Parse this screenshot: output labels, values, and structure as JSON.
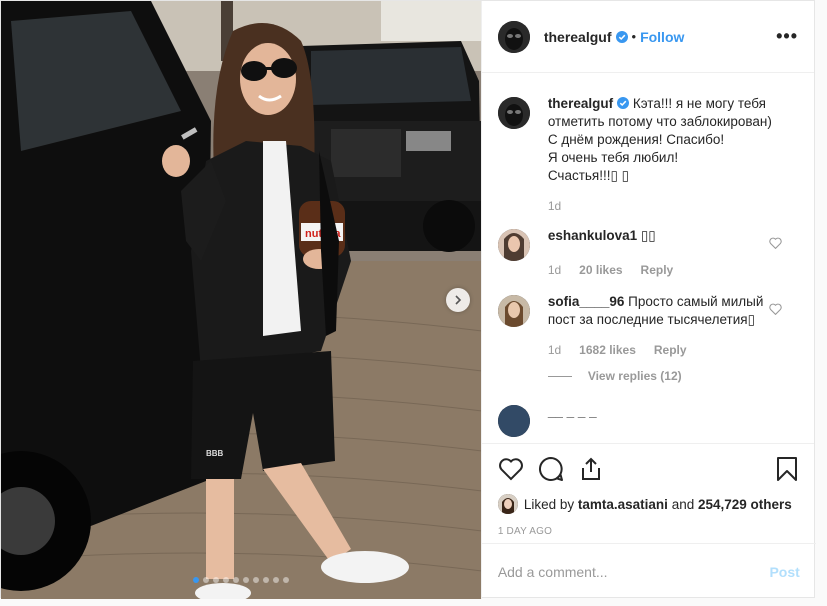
{
  "header": {
    "username": "therealguf",
    "separator": "•",
    "follow_label": "Follow",
    "more_label": "•••"
  },
  "caption": {
    "username": "therealguf",
    "lines": [
      "Кэта!!! я не могу тебя отметить потому что заблокирован)",
      "С днём рождения! Спасибо!",
      "Я очень тебя любил!",
      "Счастья!!!▯ ▯"
    ],
    "age": "1d"
  },
  "comments": [
    {
      "username": "eshankulova1",
      "text": "▯▯",
      "age": "1d",
      "likes": "20 likes",
      "reply_label": "Reply"
    },
    {
      "username": "sofia____96",
      "text": "Просто самый милый пост за последние тысячелетия▯",
      "age": "1d",
      "likes": "1682 likes",
      "reply_label": "Reply",
      "view_replies": "View replies (12)"
    },
    {
      "username": "__ _ _ _",
      "text": ""
    }
  ],
  "likes": {
    "prefix": "Liked by",
    "user": "tamta.asatiani",
    "conj": "and",
    "others": "254,729 others"
  },
  "timestamp": "1 day ago",
  "add_comment": {
    "placeholder": "Add a comment...",
    "post_label": "Post"
  },
  "icons": [
    "heart-icon",
    "comment-icon",
    "share-icon",
    "bookmark-icon",
    "verified-icon",
    "chevron-right-icon",
    "more-icon"
  ],
  "carousel": {
    "total": 10,
    "current": 1
  },
  "colors": {
    "link": "#3897f0",
    "muted": "#999999",
    "post_disabled": "#b2dffc"
  }
}
